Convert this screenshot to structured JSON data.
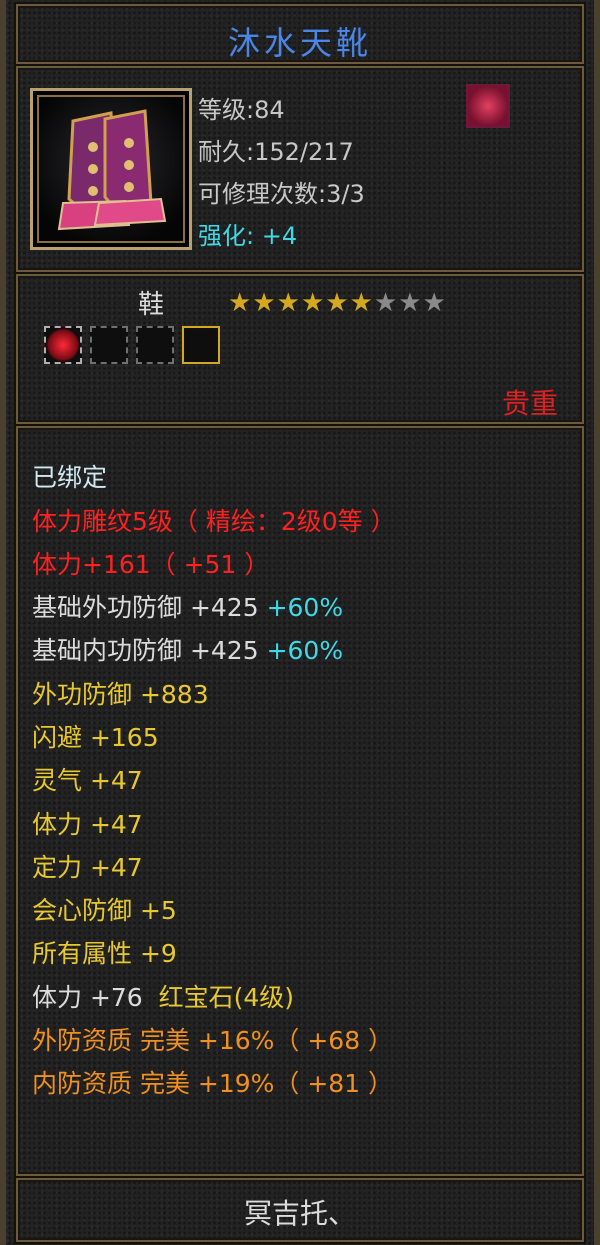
{
  "item": {
    "name": "沐水天靴",
    "level": "等级:84",
    "durability": "耐久:152/217",
    "repair": "可修理次数:3/3",
    "enhance_label": "强化:",
    "enhance_value": "+4",
    "type": "鞋",
    "stars_filled": 6,
    "stars_total": 9,
    "precious": "贵重",
    "owner": "冥吉托、"
  },
  "attributes": {
    "bound": "已绑定",
    "engrave": "体力雕纹5级（ 精绘：2级0等 ）",
    "stamina_bonus": "体力+161（ +51 ）",
    "base_outer_def": "基础外功防御  +425",
    "base_outer_def_pct": "+60%",
    "base_inner_def": "基础内功防御  +425",
    "base_inner_def_pct": "+60%",
    "outer_def": "外功防御  +883",
    "dodge": "闪避  +165",
    "spirit": "灵气  +47",
    "stamina": "体力  +47",
    "focus": "定力  +47",
    "crit_def": "会心防御  +5",
    "all_attr": "所有属性  +9",
    "gem_stat": "体力  +76",
    "gem_name": "红宝石(4级)",
    "outer_quality": "外防资质   完美  +16%（ +68 ）",
    "inner_quality": "内防资质   完美  +19%（ +81 ）"
  }
}
